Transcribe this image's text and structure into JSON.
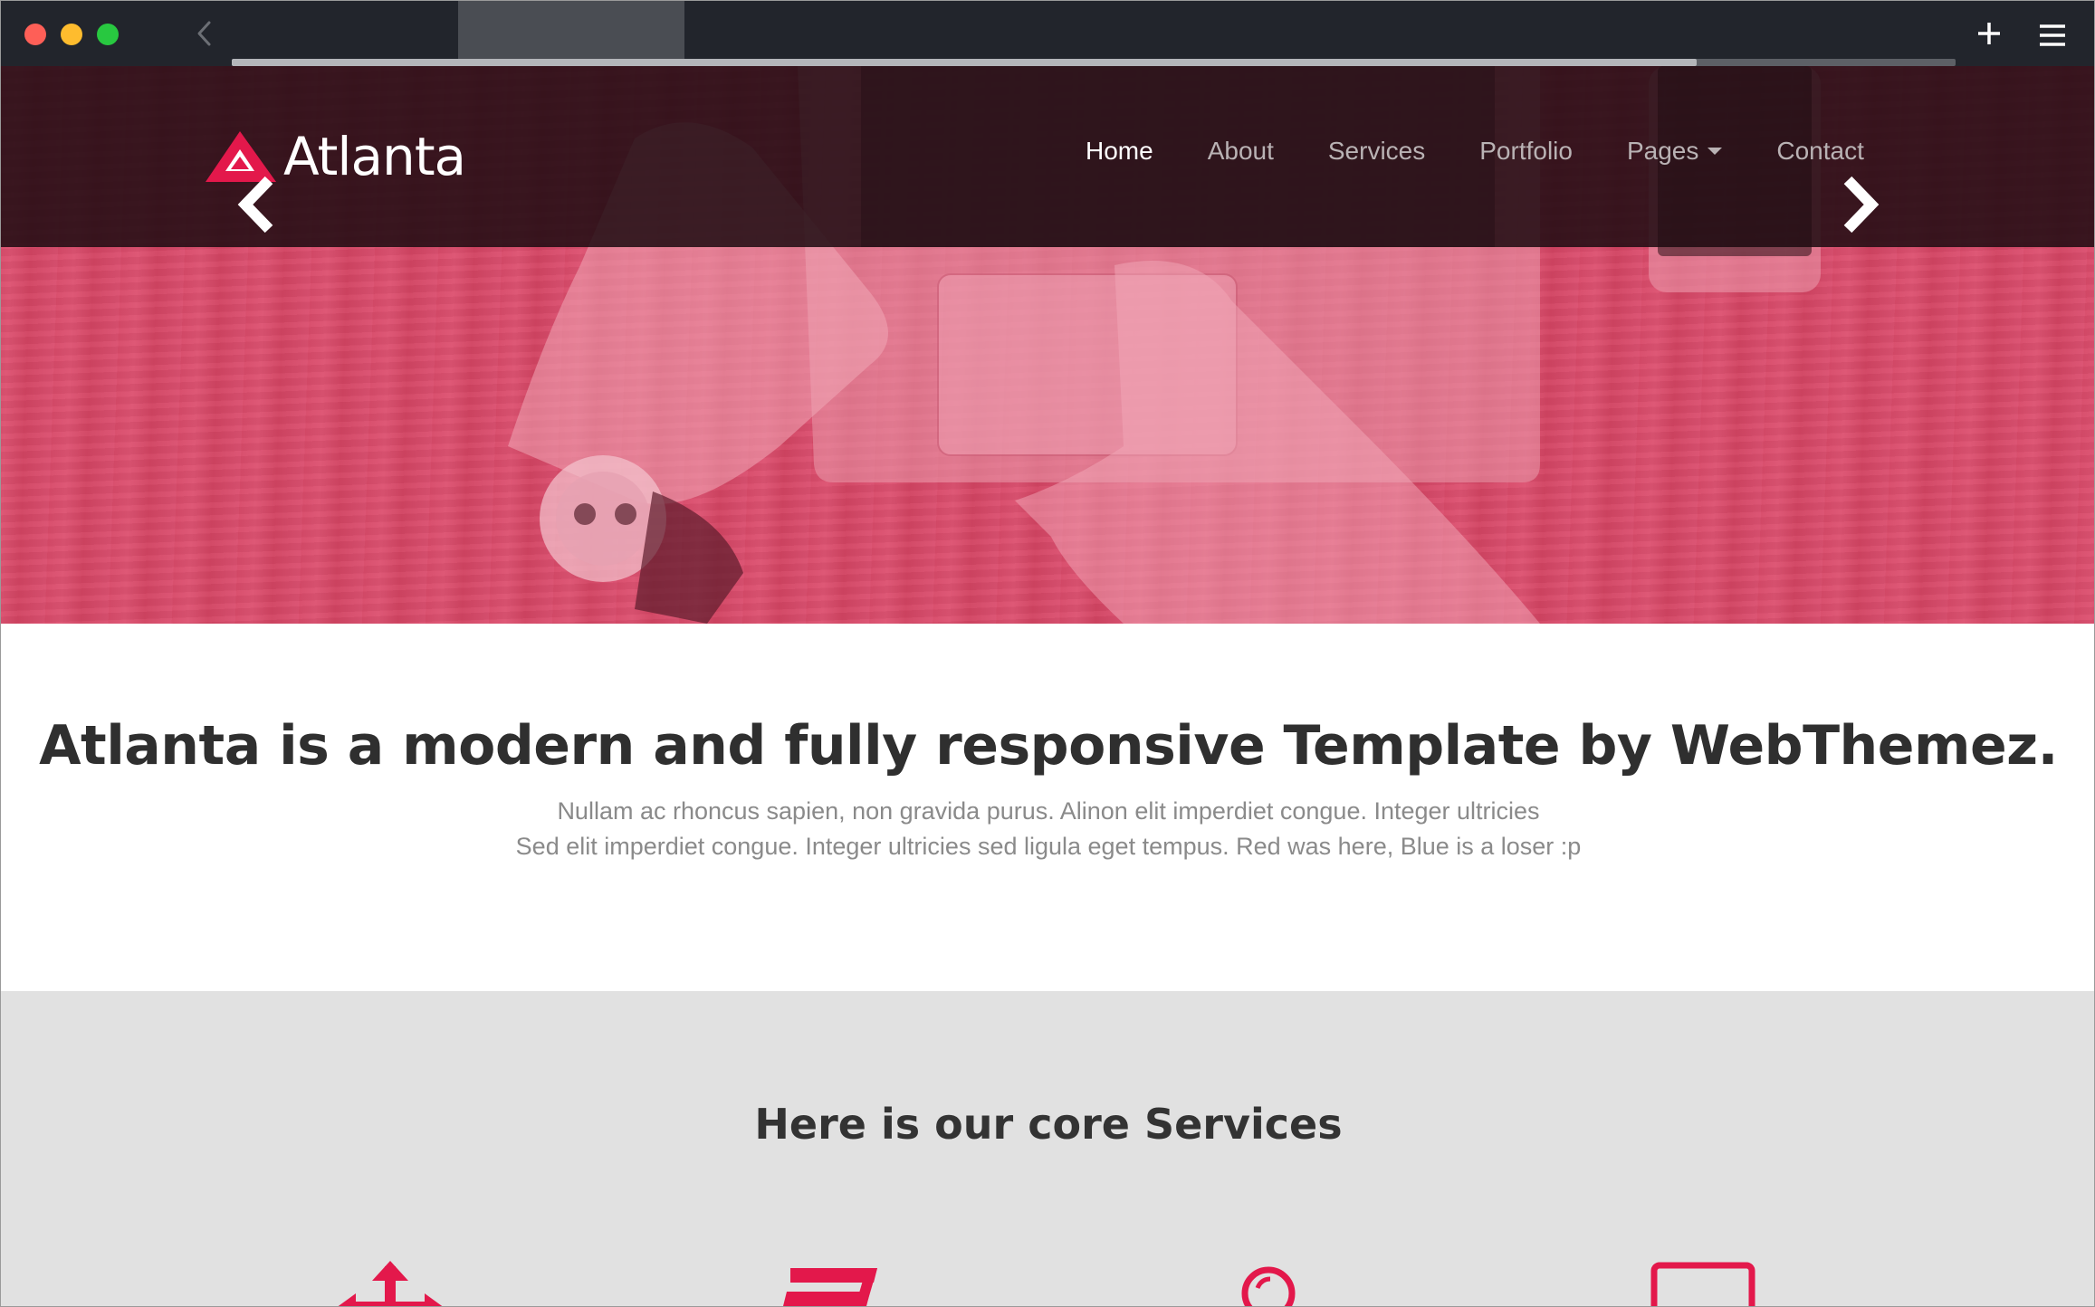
{
  "browser": {
    "page_load_progress": 0.85
  },
  "site": {
    "logo_text": "Atlanta"
  },
  "nav": {
    "items": [
      {
        "label": "Home",
        "active": true
      },
      {
        "label": "About",
        "active": false
      },
      {
        "label": "Services",
        "active": false
      },
      {
        "label": "Portfolio",
        "active": false
      },
      {
        "label": "Pages",
        "active": false,
        "has_dropdown": true
      },
      {
        "label": "Contact",
        "active": false
      }
    ]
  },
  "hero": {
    "prev_icon": "chevron-left-icon",
    "next_icon": "chevron-right-icon"
  },
  "intro": {
    "title": "Atlanta is a modern and fully responsive Template by WebThemez.",
    "line1": "Nullam ac rhoncus sapien, non gravida purus. Alinon elit imperdiet congue. Integer ultricies",
    "line2": "Sed elit imperdiet congue. Integer ultricies sed ligula eget tempus. Red was here, Blue is a loser :p"
  },
  "services": {
    "title": "Here is our core Services",
    "icons": [
      "arrows-icon",
      "css3-icon",
      "search-icon",
      "desktop-icon"
    ]
  },
  "colors": {
    "accent": "#e3184b",
    "hero_overlay": "#d84a69",
    "navbar": "#1e0c12",
    "services_bg": "#e1e1e1",
    "chrome_bg": "#22252c"
  }
}
